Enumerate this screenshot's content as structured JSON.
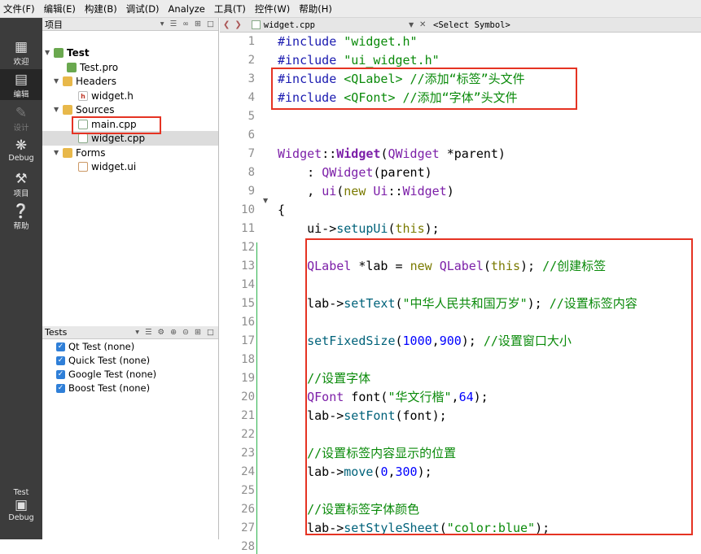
{
  "menubar": {
    "items": [
      "文件(F)",
      "编辑(E)",
      "构建(B)",
      "调试(D)",
      "Analyze",
      "工具(T)",
      "控件(W)",
      "帮助(H)"
    ]
  },
  "modebar": {
    "welcome": "欢迎",
    "edit": "编辑",
    "design": "设计",
    "debug": "Debug",
    "project": "项目",
    "help": "帮助",
    "target_project": "Test",
    "target_mode": "Debug"
  },
  "project_pane": {
    "title": "项目",
    "tree": {
      "root": "Test",
      "pro_file": "Test.pro",
      "headers": "Headers",
      "header_file": "widget.h",
      "sources": "Sources",
      "source_main": "main.cpp",
      "source_widget": "widget.cpp",
      "forms": "Forms",
      "form_file": "widget.ui"
    }
  },
  "tests_pane": {
    "title": "Tests",
    "items": [
      "Qt Test (none)",
      "Quick Test (none)",
      "Google Test (none)",
      "Boost Test (none)"
    ]
  },
  "editor": {
    "file_tab": "widget.cpp",
    "symbol": "<Select Symbol>",
    "line_numbers": [
      "1",
      "2",
      "3",
      "4",
      "5",
      "6",
      "7",
      "8",
      "9",
      "10",
      "11",
      "12",
      "13",
      "14",
      "15",
      "16",
      "17",
      "18",
      "19",
      "20",
      "21",
      "22",
      "23",
      "24",
      "25",
      "26",
      "27",
      "28"
    ],
    "code": {
      "l1_a": "#include ",
      "l1_b": "\"widget.h\"",
      "l2_a": "#include ",
      "l2_b": "\"ui_widget.h\"",
      "l3_a": "#include ",
      "l3_b": "<QLabel>",
      "l3_c": " //添加“标签”头文件",
      "l4_a": "#include ",
      "l4_b": "<QFont>",
      "l4_c": " //添加“字体”头文件",
      "l7_a": "Widget",
      "l7_b": "::",
      "l7_c": "Widget",
      "l7_d": "(",
      "l7_e": "QWidget",
      "l7_f": " *parent)",
      "l8_a": "    : ",
      "l8_b": "QWidget",
      "l8_c": "(parent)",
      "l9_a": "    , ",
      "l9_b": "ui",
      "l9_c": "(",
      "l9_d": "new",
      "l9_e": " ",
      "l9_f": "Ui",
      "l9_g": "::",
      "l9_h": "Widget",
      "l9_i": ")",
      "l10": "{",
      "l11_a": "    ui->",
      "l11_b": "setupUi",
      "l11_c": "(",
      "l11_d": "this",
      "l11_e": ");",
      "l13_a": "    ",
      "l13_b": "QLabel",
      "l13_c": " *lab = ",
      "l13_d": "new",
      "l13_e": " ",
      "l13_f": "QLabel",
      "l13_g": "(",
      "l13_h": "this",
      "l13_i": "); ",
      "l13_j": "//创建标签",
      "l15_a": "    lab->",
      "l15_b": "setText",
      "l15_c": "(",
      "l15_d": "\"中华人民共和国万岁\"",
      "l15_e": "); ",
      "l15_f": "//设置标签内容",
      "l17_a": "    ",
      "l17_b": "setFixedSize",
      "l17_c": "(",
      "l17_d": "1000",
      "l17_e": ",",
      "l17_f": "900",
      "l17_g": "); ",
      "l17_h": "//设置窗口大小",
      "l19": "    //设置字体",
      "l20_a": "    ",
      "l20_b": "QFont",
      "l20_c": " font(",
      "l20_d": "\"华文行楷\"",
      "l20_e": ",",
      "l20_f": "64",
      "l20_g": ");",
      "l21_a": "    lab->",
      "l21_b": "setFont",
      "l21_c": "(font);",
      "l23": "    //设置标签内容显示的位置",
      "l24_a": "    lab->",
      "l24_b": "move",
      "l24_c": "(",
      "l24_d": "0",
      "l24_e": ",",
      "l24_f": "300",
      "l24_g": ");",
      "l26": "    //设置标签字体颜色",
      "l27_a": "    lab->",
      "l27_b": "setStyleSheet",
      "l27_c": "(",
      "l27_d": "\"color:blue\"",
      "l27_e": ");"
    }
  },
  "colors": {
    "highlight_box": "#e53323",
    "mode_bar": "#3c3c3c",
    "string": "#0a8a0a",
    "preprocessor": "#1a1ab0",
    "type": "#7c1fa8"
  }
}
